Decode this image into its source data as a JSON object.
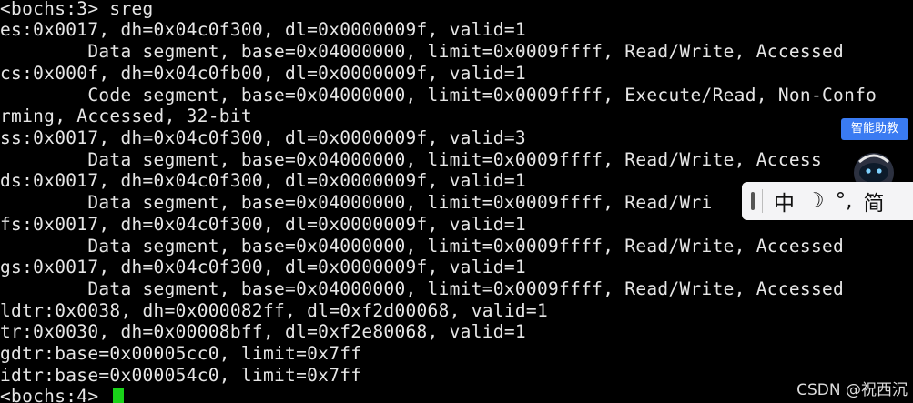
{
  "terminal": {
    "lines": [
      "<bochs:3> sreg",
      "es:0x0017, dh=0x04c0f300, dl=0x0000009f, valid=1",
      "        Data segment, base=0x04000000, limit=0x0009ffff, Read/Write, Accessed",
      "cs:0x000f, dh=0x04c0fb00, dl=0x0000009f, valid=1",
      "        Code segment, base=0x04000000, limit=0x0009ffff, Execute/Read, Non-Confo",
      "rming, Accessed, 32-bit",
      "ss:0x0017, dh=0x04c0f300, dl=0x0000009f, valid=3",
      "        Data segment, base=0x04000000, limit=0x0009ffff, Read/Write, Access",
      "ds:0x0017, dh=0x04c0f300, dl=0x0000009f, valid=1",
      "        Data segment, base=0x04000000, limit=0x0009ffff, Read/Wri",
      "fs:0x0017, dh=0x04c0f300, dl=0x0000009f, valid=1",
      "        Data segment, base=0x04000000, limit=0x0009ffff, Read/Write, Accessed",
      "gs:0x0017, dh=0x04c0f300, dl=0x0000009f, valid=1",
      "        Data segment, base=0x04000000, limit=0x0009ffff, Read/Write, Accessed",
      "ldtr:0x0038, dh=0x000082ff, dl=0xf2d00068, valid=1",
      "tr:0x0030, dh=0x00008bff, dl=0xf2e80068, valid=1",
      "gdtr:base=0x00005cc0, limit=0x7ff",
      "idtr:base=0x000054c0, limit=0x7ff",
      "<bochs:4> "
    ],
    "cursor_color": "#19d319"
  },
  "ime_toolbar": {
    "items": [
      "中",
      "☽",
      "°,",
      "简"
    ]
  },
  "helper": {
    "badge": "智能助教",
    "avatar_icon": "astronaut-icon"
  },
  "watermark": "CSDN @祝西沉"
}
